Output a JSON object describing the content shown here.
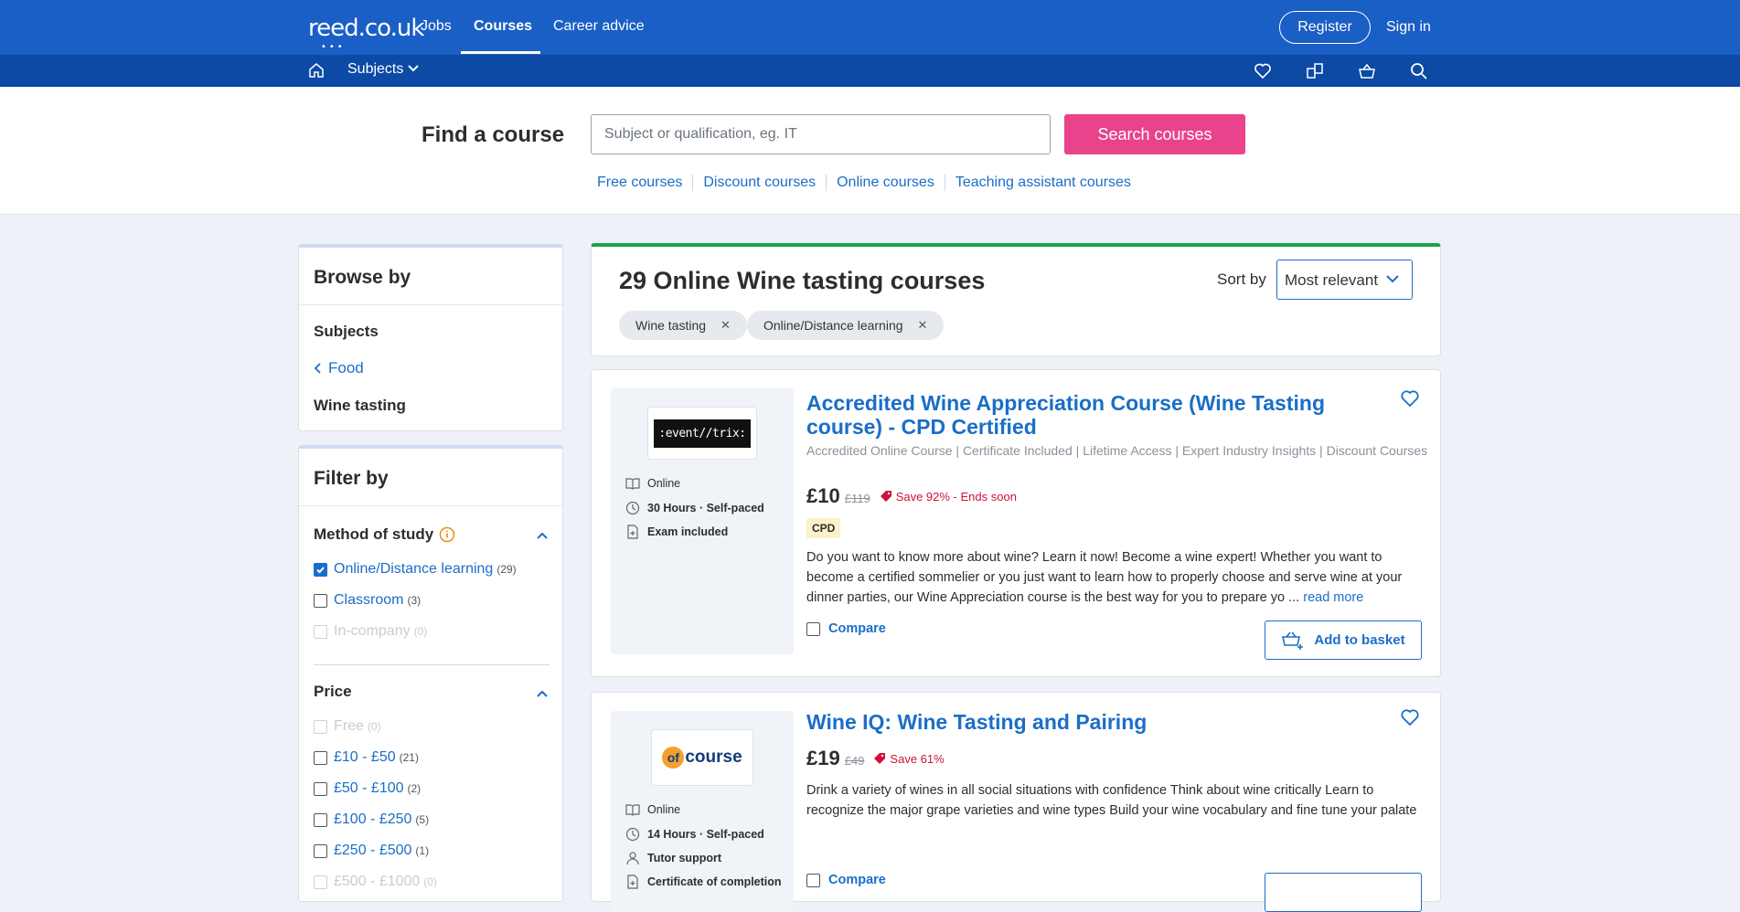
{
  "header": {
    "logo": "reed.co.uk",
    "nav": [
      "Jobs",
      "Courses",
      "Career advice"
    ],
    "register": "Register",
    "signin": "Sign in",
    "subjects": "Subjects"
  },
  "search": {
    "title": "Find a course",
    "placeholder": "Subject or qualification, eg. IT",
    "button": "Search courses",
    "quick_links": [
      "Free courses",
      "Discount courses",
      "Online courses",
      "Teaching assistant courses"
    ]
  },
  "browse": {
    "title": "Browse by",
    "subjects_label": "Subjects",
    "parent": "Food",
    "current": "Wine tasting"
  },
  "filter": {
    "title": "Filter by",
    "method": {
      "title": "Method of study",
      "options": [
        {
          "label": "Online/Distance learning",
          "count": "(29)",
          "checked": true,
          "disabled": false
        },
        {
          "label": "Classroom",
          "count": "(3)",
          "checked": false,
          "disabled": false
        },
        {
          "label": "In-company",
          "count": "(0)",
          "checked": false,
          "disabled": true
        }
      ]
    },
    "price": {
      "title": "Price",
      "options": [
        {
          "label": "Free",
          "count": "(0)",
          "disabled": true
        },
        {
          "label": "£10 - £50",
          "count": "(21)",
          "disabled": false
        },
        {
          "label": "£50 - £100",
          "count": "(2)",
          "disabled": false
        },
        {
          "label": "£100 - £250",
          "count": "(5)",
          "disabled": false
        },
        {
          "label": "£250 - £500",
          "count": "(1)",
          "disabled": false
        },
        {
          "label": "£500 - £1000",
          "count": "(0)",
          "disabled": true
        }
      ]
    }
  },
  "results": {
    "title": "29 Online Wine tasting courses",
    "sort_label": "Sort by",
    "sort_value": "Most relevant",
    "chips": [
      "Wine tasting",
      "Online/Distance learning"
    ]
  },
  "courses": [
    {
      "provider_logo": ":event//trix:",
      "meta": [
        "Online",
        "30 Hours · Self-paced",
        "Exam included"
      ],
      "title": "Accredited Wine Appreciation Course (Wine Tasting course) - CPD Certified",
      "subtitle": "Accredited Online Course | Certificate Included | Lifetime Access | Expert Industry Insights | Discount Courses",
      "price": "£10",
      "was": "£119",
      "save": "Save 92% - Ends soon",
      "badge": "CPD",
      "description": "Do you want to know more about wine? Learn it now! Become a wine expert! Whether you want to become a certified sommelier or you just want to learn how to properly choose and serve wine at your dinner parties, our Wine Appreciation course is the best way for you to prepare yo ...",
      "read_more": "read more",
      "compare": "Compare",
      "basket": "Add to basket"
    },
    {
      "provider_logo": "ofcourse",
      "meta": [
        "Online",
        "14 Hours · Self-paced",
        "Tutor support",
        "Certificate of completion"
      ],
      "title": "Wine IQ: Wine Tasting and Pairing",
      "price": "£19",
      "was": "£49",
      "save": "Save 61%",
      "description": "Drink a variety of wines in all social situations with confidence Think about wine critically Learn to recognize the major grape varieties and wine types Build your wine vocabulary and fine tune your palate",
      "compare": "Compare"
    }
  ],
  "colors": {
    "brand": "#1a5fc5",
    "brand_dark": "#0c4aa5",
    "accent": "#e8438b",
    "link": "#1a6ec8",
    "success": "#1aa34a",
    "sale": "#d0103a"
  }
}
